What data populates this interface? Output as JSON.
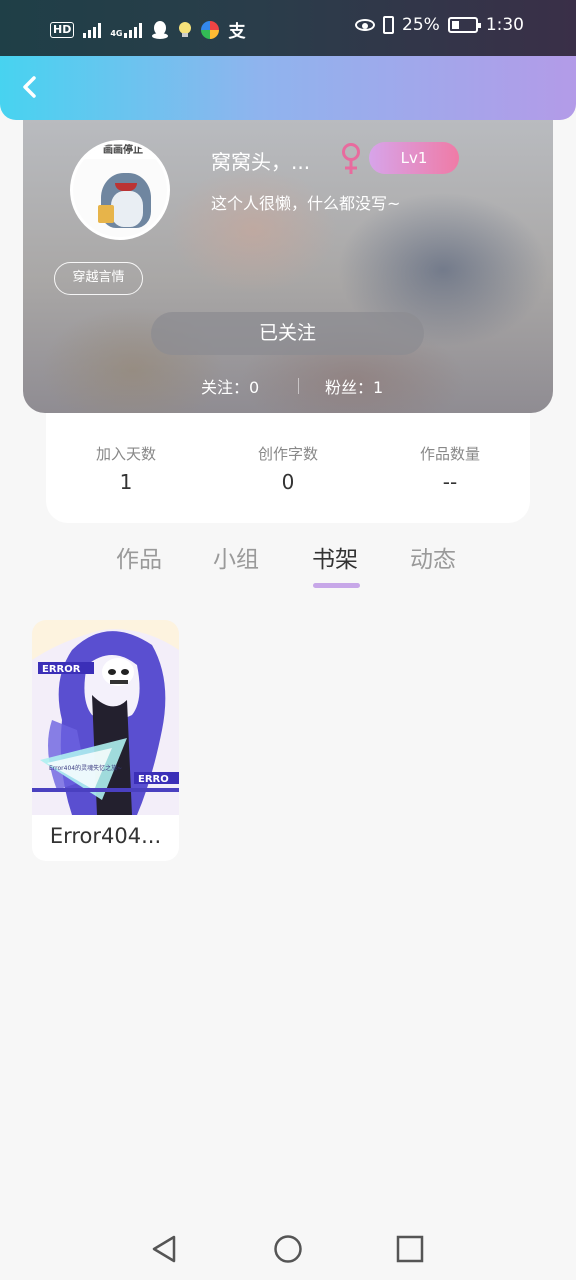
{
  "status_bar": {
    "left_icons": [
      "hd-icon",
      "signal-icon",
      "4g-icon",
      "signal-icon",
      "qq-icon",
      "bulb-icon",
      "color-app-icon",
      "alipay-icon"
    ],
    "hd_label": "HD",
    "network_label": "4G",
    "battery_percent": "25%",
    "time": "1:30"
  },
  "header": {
    "back_icon": "chevron-left-icon"
  },
  "profile": {
    "avatar_banner": "画画停止",
    "username": "窝窝头，...",
    "gender": "female",
    "level": "Lv1",
    "bio": "这个人很懒，什么都没写~",
    "tag": "穿越言情",
    "follow_button": "已关注",
    "following": "关注：0",
    "fans": "粉丝：1"
  },
  "stats": [
    {
      "label": "加入天数",
      "value": "1"
    },
    {
      "label": "创作字数",
      "value": "0"
    },
    {
      "label": "作品数量",
      "value": "--"
    }
  ],
  "tabs": [
    {
      "label": "作品",
      "active": false
    },
    {
      "label": "小组",
      "active": false
    },
    {
      "label": "书架",
      "active": true
    },
    {
      "label": "动态",
      "active": false
    }
  ],
  "books": [
    {
      "title": "Error404...",
      "cover_text": "Error404的灵魂失忆之旅~",
      "cover_badge_left": "ERROR",
      "cover_badge_right": "ERRO"
    }
  ],
  "nav": {
    "back_icon": "triangle-back-icon",
    "home_icon": "circle-home-icon",
    "recents_icon": "square-recents-icon"
  },
  "colors": {
    "header_start": "#47d3f0",
    "header_end": "#b39be8",
    "level_badge_start": "#d7a4ea",
    "level_badge_end": "#ef7ba6",
    "gender_female": "#e86b9e",
    "tab_indicator": "#c7a7e8"
  }
}
